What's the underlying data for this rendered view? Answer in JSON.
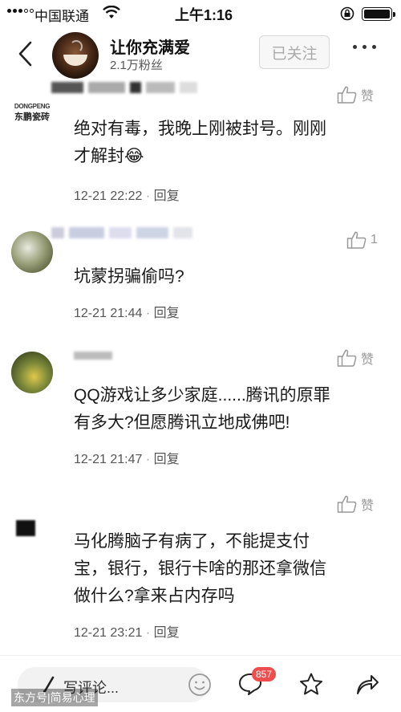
{
  "status_bar": {
    "carrier": "中国联通",
    "time": "上午1:16"
  },
  "header": {
    "account_name": "让你充满爱",
    "fans": "2.1万粉丝",
    "follow_label": "已关注"
  },
  "comments": [
    {
      "avatar_text_1": "DONGPENG",
      "avatar_text_2": "东鹏瓷砖",
      "text_line1": "绝对有毒，我晚上刚被封号。刚刚",
      "text_line2": "才解封",
      "emoji": "😂",
      "time": "12-21 22:22",
      "reply_label": "回复",
      "like_label": "赞"
    },
    {
      "text_line1": "坑蒙拐骗偷吗?",
      "time": "12-21 21:44",
      "reply_label": "回复",
      "like_count": "1"
    },
    {
      "text_line1": "QQ游戏让多少家庭......腾讯的原罪",
      "text_line2": "有多大?但愿腾讯立地成佛吧!",
      "time": "12-21 21:47",
      "reply_label": "回复",
      "like_label": "赞"
    },
    {
      "text_line1": "马化腾脑子有病了，不能提支付",
      "text_line2": "宝，银行，银行卡啥的那还拿微信",
      "text_line3": "做什么?拿来占内存吗",
      "time": "12-21 23:21",
      "reply_label": "回复",
      "like_label": "赞"
    }
  ],
  "bottom_bar": {
    "input_placeholder": "写评论...",
    "comment_count": "857"
  },
  "watermark": "东方号|简易心理",
  "icons": {
    "back": "chevron-left-icon",
    "more": "more-dots-icon",
    "like": "thumbs-up-icon",
    "emoji": "smiley-icon",
    "comment": "speech-bubble-icon",
    "favorite": "star-icon",
    "share": "share-arrow-icon"
  },
  "colors": {
    "badge": "#ee4d4d",
    "follow_text": "#aaaaaa"
  }
}
